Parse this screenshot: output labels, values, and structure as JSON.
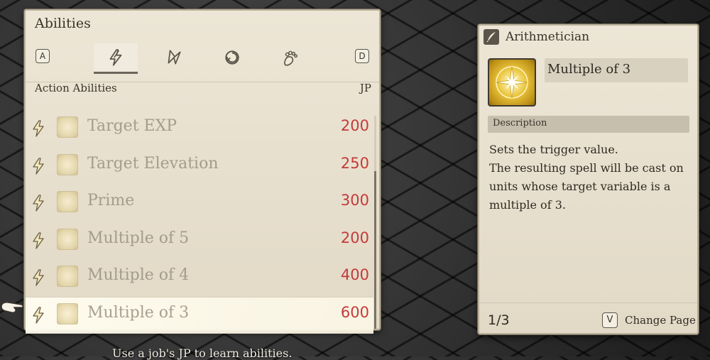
{
  "abilities_panel": {
    "title": "Abilities",
    "tabs": [
      {
        "key": "A"
      },
      {
        "name": "action-abilities",
        "icon": "lightning-bolt-icon",
        "active": true
      },
      {
        "name": "support-abilities",
        "icon": "bolt-arrow-icon"
      },
      {
        "name": "reaction-abilities",
        "icon": "swirl-icon"
      },
      {
        "name": "movement-abilities",
        "icon": "footprint-icon"
      },
      {
        "key": "D"
      }
    ],
    "section_label": "Action Abilities",
    "cost_header": "JP",
    "rows": [
      {
        "name": "Target EXP",
        "cost": "200",
        "selected": false
      },
      {
        "name": "Target Elevation",
        "cost": "250",
        "selected": false
      },
      {
        "name": "Prime",
        "cost": "300",
        "selected": false
      },
      {
        "name": "Multiple of 5",
        "cost": "200",
        "selected": false
      },
      {
        "name": "Multiple of 4",
        "cost": "400",
        "selected": false
      },
      {
        "name": "Multiple of 3",
        "cost": "600",
        "selected": true
      }
    ]
  },
  "detail_panel": {
    "job": "Arithmetician",
    "ability_name": "Multiple of 3",
    "description_label": "Description",
    "description_lines": [
      "Sets the trigger value.",
      "The resulting spell will be cast on",
      "units whose target variable is a",
      "multiple of 3."
    ],
    "page": "1/3",
    "page_key": "V",
    "change_page_label": "Change Page"
  },
  "hint_text": "Use a job's JP to learn abilities.",
  "colors": {
    "panel_bg": "#e8e0cf",
    "cost_red": "#c33b3b",
    "gold": "#e9c33a"
  }
}
